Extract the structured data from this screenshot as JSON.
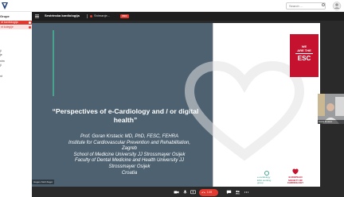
{
  "topbar": {
    "search_placeholder": "Search ..."
  },
  "sidebar": {
    "title": "Grupe",
    "items": [
      {
        "label": "nt kardiologija",
        "state": "active"
      },
      {
        "label": "nt kolegije",
        "state": "alt"
      }
    ],
    "links": [
      "ji",
      "je",
      "nim",
      "ji",
      "nt"
    ]
  },
  "meeting": {
    "title": "Sestrinska kardiologija",
    "subtitle": "Snimanje...",
    "live_badge": "REC",
    "host_label": "Hagen-Stoll Zagor"
  },
  "slide": {
    "title": "“Perspectives of e-Cardiology and / or digital health”",
    "body_lines": [
      "Prof. Goran Krstacic MD, PhD, FESC, FEHRA",
      "Institute for Cardiovascular Prevention and Rehabilitation,",
      "Zagreb",
      "School of Medicine University JJ Strossmayer Osijek",
      "Faculty of Dental Medicine and Health University JJ",
      "Strossmayer Osijek",
      "Croatia"
    ],
    "badge_we": "WE",
    "badge_are_the": "ARE THE",
    "badge_esc": "ESC",
    "footer_logo1": "e-cardiology",
    "footer_logo1_sub": "ESC working group",
    "footer_logo2": "EUROPEAN SOCIETY OF CARDIOLOGY"
  },
  "participant": {
    "name": "Goran Krstacic"
  },
  "controls": {
    "leave_label": "1:19"
  },
  "colors": {
    "accent_red": "#e23a2f",
    "slide_bg": "#4d6170",
    "esc_red": "#c4122f",
    "teal": "#48a28d"
  }
}
